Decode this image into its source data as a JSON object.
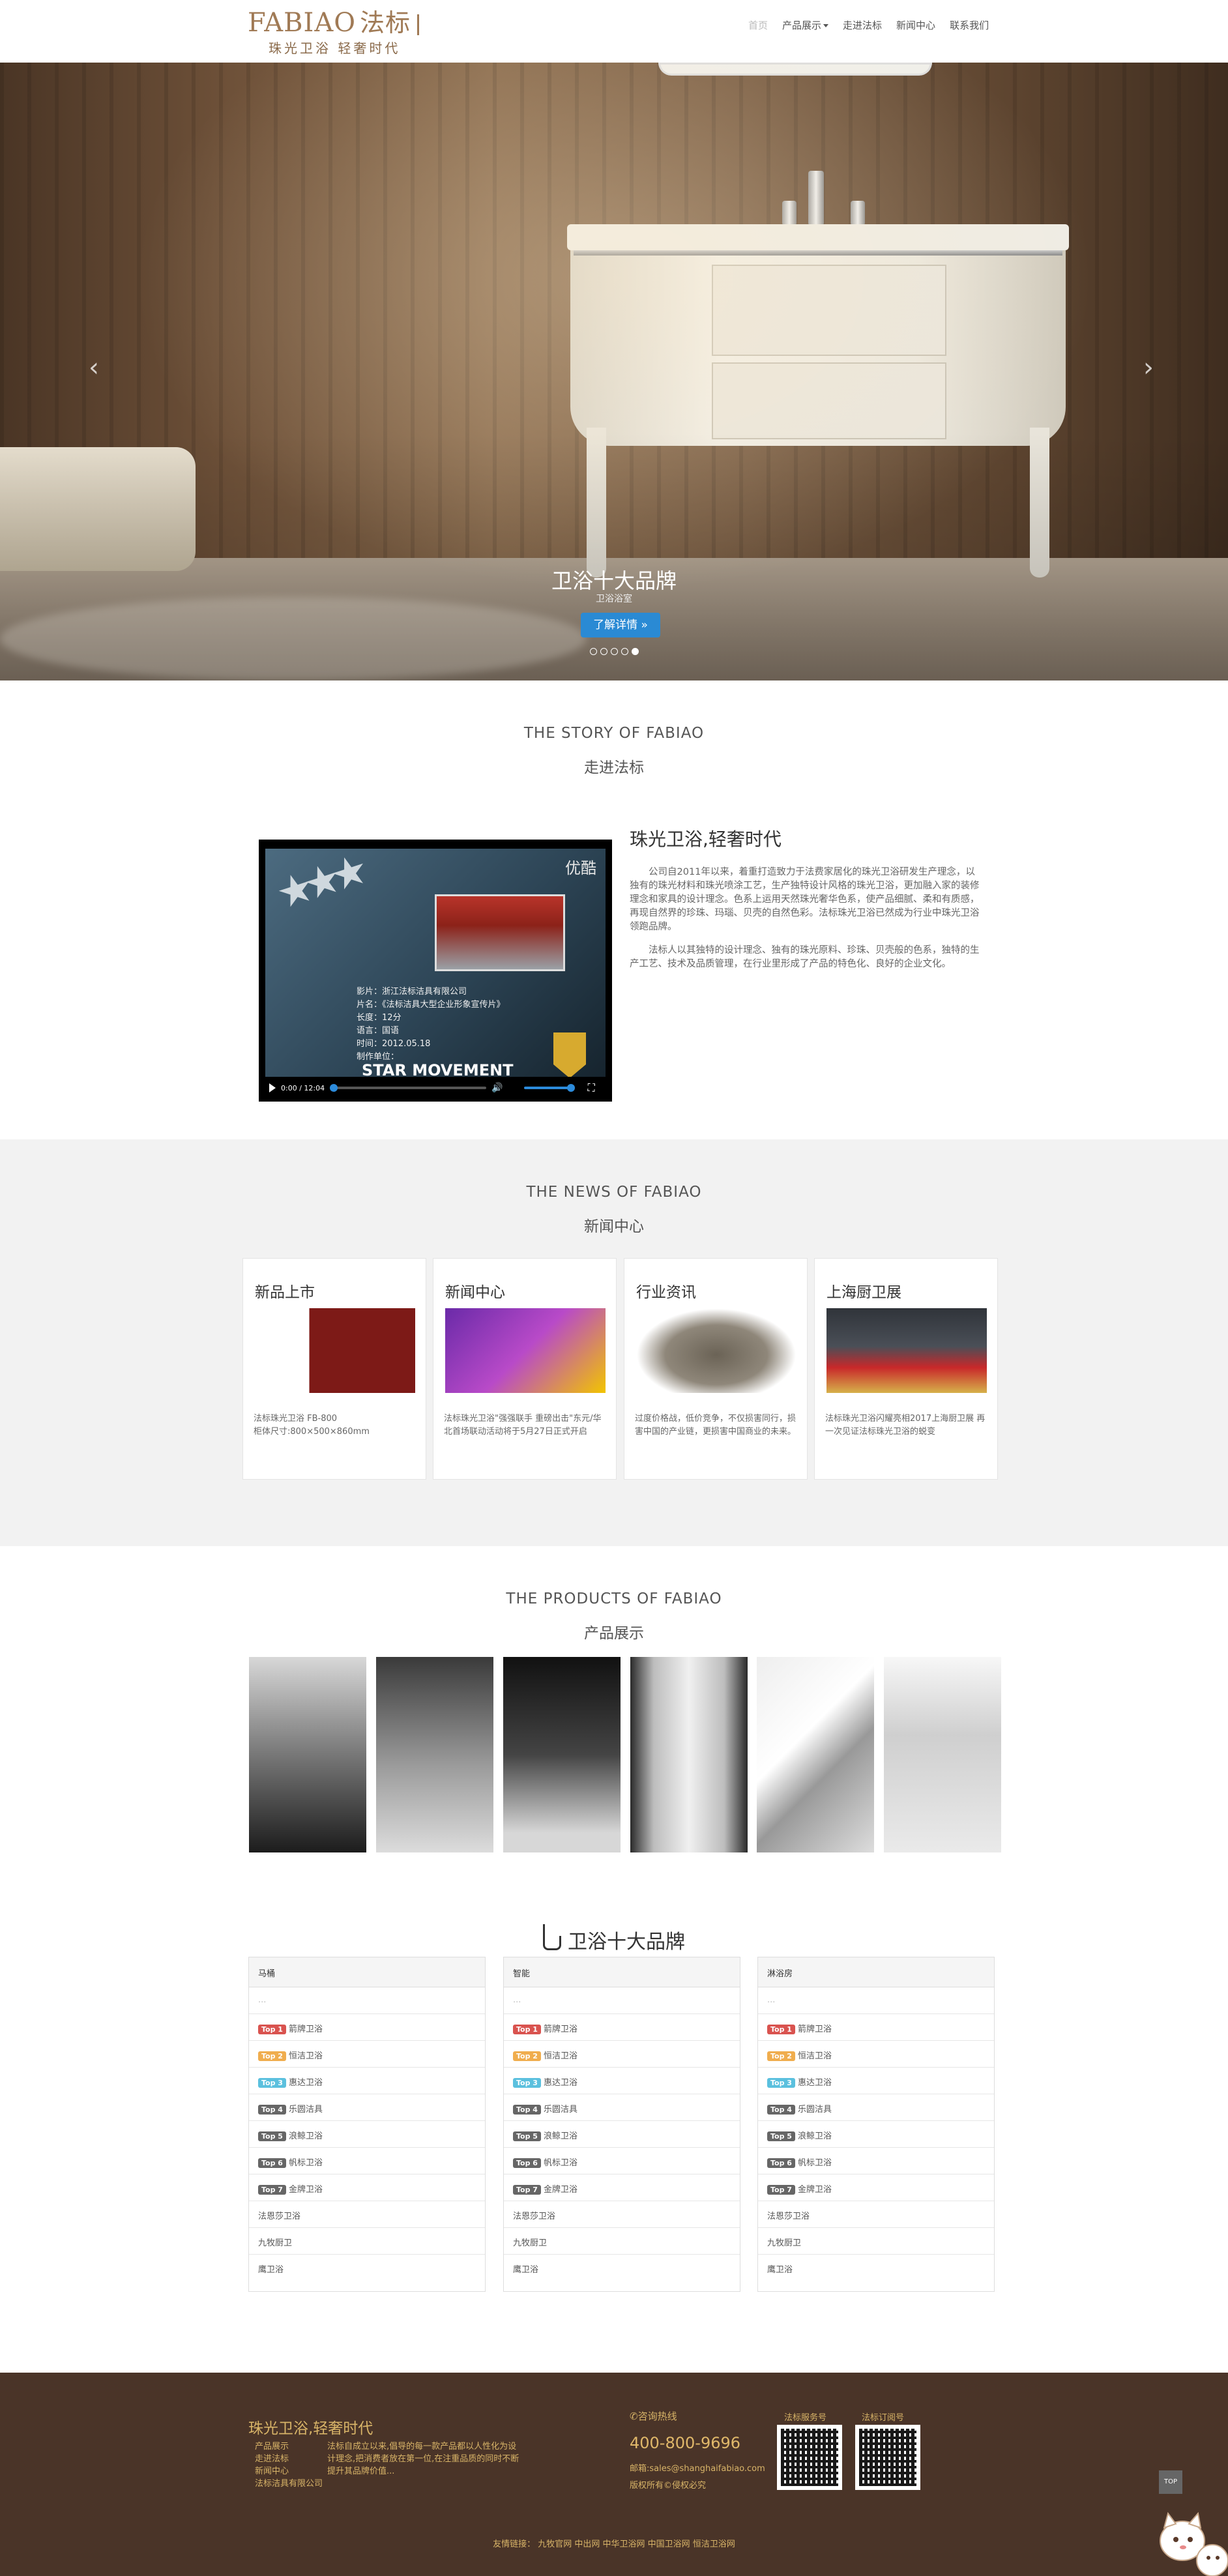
{
  "header": {
    "logo_text": "FABIAO",
    "logo_cn": "法标",
    "logo_slogan": "珠光卫浴 轻奢时代",
    "nav": [
      "首页",
      "产品展示",
      "走进法标",
      "新闻中心",
      "联系我们"
    ]
  },
  "hero": {
    "title": "卫浴十大品牌",
    "subtitle": "卫浴浴室",
    "button": "了解详情 »",
    "prev_icon": "‹",
    "next_icon": "›",
    "slides": 5,
    "active_slide": 5
  },
  "story": {
    "heading_en": "THE STORY OF FABIAO",
    "heading_cn": "走进法标",
    "title": "珠光卫浴,轻奢时代",
    "para1": "公司自2011年以来，着重打造致力于法费家居化的珠光卫浴研发生产理念，以独有的珠光材料和珠光喷涂工艺，生产独特设计风格的珠光卫浴，更加融入家的装修理念和家具的设计理念。色系上运用天然珠光奢华色系，使产品细腻、柔和有质感，再现自然界的珍珠、玛瑙、贝壳的自然色彩。法标珠光卫浴已然成为行业中珠光卫浴领跑品牌。",
    "para2": "法标人以其独特的设计理念、独有的珠光原料、珍珠、贝壳般的色系，独特的生产工艺、技术及品质管理，在行业里形成了产品的特色化、良好的企业文化。",
    "video": {
      "logo": "优酷",
      "info": "影片：浙江法标洁具有限公司\n片名：《法标洁具大型企业形象宣传片》\n长度：12分\n语言：国语\n时间：2012.05.18\n制作单位：",
      "brand": "STAR MOVEMENT",
      "time": "0:00 / 12:04"
    }
  },
  "news": {
    "heading_en": "THE NEWS OF FABIAO",
    "heading_cn": "新闻中心",
    "cards": [
      {
        "title": "新品上市",
        "text": "法标珠光卫浴 FB-800\n柜体尺寸:800×500×860mm"
      },
      {
        "title": "新闻中心",
        "text": "法标珠光卫浴\"强强联手 重磅出击\"东元/华北首场联动活动将于5月27日正式开启"
      },
      {
        "title": "行业资讯",
        "text": "过度价格战，低价竞争，不仅损害同行，损害中国的产业链，更损害中国商业的未来。"
      },
      {
        "title": "上海厨卫展",
        "text": "法标珠光卫浴闪耀亮相2017上海厨卫展 再一次见证法标珠光卫浴的蜕变"
      }
    ]
  },
  "products": {
    "heading_en": "THE PRODUCTS OF FABIAO",
    "heading_cn": "产品展示",
    "items": [
      "product-1",
      "product-2",
      "product-3",
      "product-4",
      "product-5",
      "product-6"
    ]
  },
  "brands": {
    "title": "卫浴十大品牌",
    "columns": [
      {
        "header": "马桶",
        "placeholder": "...",
        "tops": [
          "箭牌卫浴",
          "恒洁卫浴",
          "惠达卫浴",
          "乐圆洁具",
          "浪鲸卫浴",
          "帆标卫浴",
          "金牌卫浴"
        ],
        "others": [
          "法恩莎卫浴",
          "九牧厨卫",
          "鹰卫浴"
        ]
      },
      {
        "header": "智能",
        "placeholder": "...",
        "tops": [
          "箭牌卫浴",
          "恒洁卫浴",
          "惠达卫浴",
          "乐圆洁具",
          "浪鲸卫浴",
          "帆标卫浴",
          "金牌卫浴"
        ],
        "others": [
          "法恩莎卫浴",
          "九牧厨卫",
          "鹰卫浴"
        ]
      },
      {
        "header": "淋浴房",
        "placeholder": "...",
        "tops": [
          "箭牌卫浴",
          "恒洁卫浴",
          "惠达卫浴",
          "乐圆洁具",
          "浪鲸卫浴",
          "帆标卫浴",
          "金牌卫浴"
        ],
        "others": [
          "法恩莎卫浴",
          "九牧厨卫",
          "鹰卫浴"
        ]
      }
    ],
    "badges": [
      "Top 1",
      "Top 2",
      "Top 3",
      "Top 4",
      "Top 5",
      "Top 6",
      "Top 7"
    ],
    "badge_colors": [
      "#d9534f",
      "#f0ad4e",
      "#5bc0de",
      "#666666",
      "#666666",
      "#666666",
      "#666666"
    ]
  },
  "footer": {
    "slogan": "珠光卫浴,轻奢时代",
    "links": [
      "产品展示",
      "走进法标",
      "新闻中心",
      "法标洁具有限公司"
    ],
    "about": "法标自成立以来,倡导的每一款产品都以人性化为设计理念,把消费者放在第一位,在注重品质的同时不断提升其品牌价值...",
    "hotline_label": "咨询热线",
    "phone": "400-800-9696",
    "email": "邮箱:sales@shanghaifabiao.com",
    "copyright": "版权所有©侵权必究",
    "qr1_label": "法标服务号",
    "qr2_label": "法标订阅号",
    "friends": "友情链接： 九牧官网 中出网 中华卫浴网 中国卫浴网 恒洁卫浴网",
    "top_button": "TOP"
  },
  "colors": {
    "accent_gold": "#d8b468",
    "footer_bg": "#4a3428",
    "button_blue": "#2a8ad4",
    "news_bg": "#f2f2f2"
  }
}
